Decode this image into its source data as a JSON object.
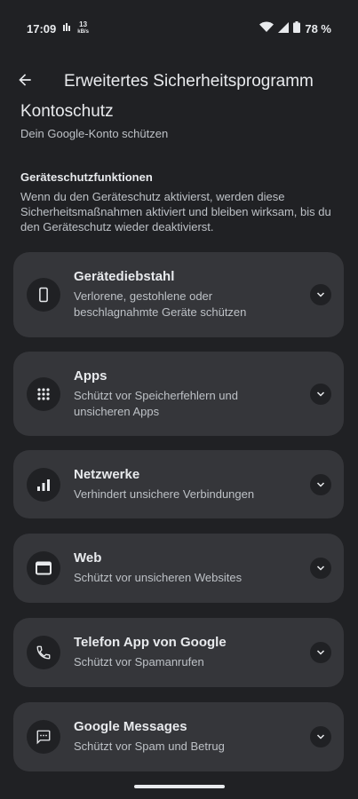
{
  "status": {
    "time": "17:09",
    "net_speed_value": "13",
    "net_speed_unit": "kB/s",
    "battery": "78 %"
  },
  "app_bar": {
    "title": "Erweitertes Sicherheitsprogramm"
  },
  "account": {
    "title": "Kontoschutz",
    "subtitle": "Dein Google-Konto schützen"
  },
  "device_protection": {
    "heading": "Geräteschutzfunktionen",
    "description": "Wenn du den Geräteschutz aktivierst, werden diese Sicherheitsmaßnahmen aktiviert und bleiben wirksam, bis du den Geräteschutz wieder deaktivierst."
  },
  "cards": [
    {
      "title": "Gerätediebstahl",
      "desc": "Verlorene, gestohlene oder beschlagnahmte Geräte schützen",
      "icon": "phone-icon"
    },
    {
      "title": "Apps",
      "desc": "Schützt vor Speicherfehlern und unsicheren Apps",
      "icon": "apps-grid-icon"
    },
    {
      "title": "Netzwerke",
      "desc": "Verhindert unsichere Verbindungen",
      "icon": "signal-bars-icon"
    },
    {
      "title": "Web",
      "desc": "Schützt vor unsicheren Websites",
      "icon": "browser-window-icon"
    },
    {
      "title": "Telefon App von Google",
      "desc": "Schützt vor Spamanrufen",
      "icon": "phone-call-icon"
    },
    {
      "title": "Google Messages",
      "desc": "Schützt vor Spam und Betrug",
      "icon": "message-icon"
    }
  ],
  "colors": {
    "background": "#202124",
    "card": "#35363a",
    "text": "#e8eaed",
    "secondary_text": "#bdc1c6"
  }
}
